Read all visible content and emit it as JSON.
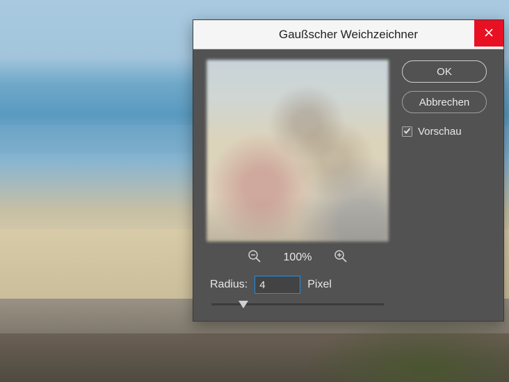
{
  "dialog": {
    "title": "Gaußscher Weichzeichner",
    "ok_label": "OK",
    "cancel_label": "Abbrechen",
    "preview_checkbox": {
      "label": "Vorschau",
      "checked": true
    },
    "zoom_level": "100%",
    "radius": {
      "label": "Radius:",
      "value": "4",
      "unit": "Pixel"
    }
  }
}
